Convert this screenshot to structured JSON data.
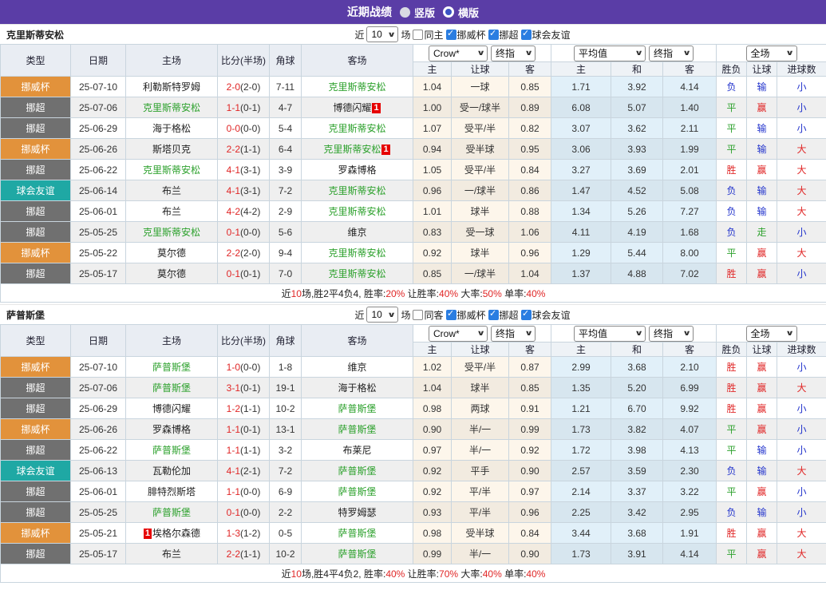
{
  "title_bar": {
    "title": "近期战绩",
    "radio_vertical": "竖版",
    "radio_horizontal": "横版"
  },
  "colors": {
    "header_purple": "#5a3da6",
    "league_cup_orange": "#e2923b",
    "league_top_gray": "#707070",
    "league_friendly_teal": "#1fa8a4",
    "win_red": "#e02626",
    "draw_green": "#2da12d",
    "lose_blue": "#2233cc",
    "highlight_team_green": "#2da12d"
  },
  "sections": [
    {
      "team": "克里斯蒂安松",
      "filter": {
        "near": "近",
        "count": "10",
        "unit": "场",
        "same": "同主",
        "cups": [
          "挪威杯",
          "挪超",
          "球会友谊"
        ]
      },
      "table": {
        "selects": {
          "book": "Crow*",
          "final1": "终指",
          "avg": "平均值",
          "final2": "终指",
          "scope": "全场"
        },
        "headers": {
          "type": "类型",
          "date": "日期",
          "home": "主场",
          "score": "比分(半场)",
          "corner": "角球",
          "away": "客场"
        },
        "sub": [
          "主",
          "让球",
          "客",
          "主",
          "和",
          "客",
          "胜负",
          "让球",
          "进球数"
        ]
      },
      "rows": [
        {
          "league": "挪威杯",
          "date": "25-07-10",
          "home": {
            "name": "利勒斯特罗姆"
          },
          "ft": "2-0",
          "ht": "(2-0)",
          "corner": "7-11",
          "away": {
            "name": "克里斯蒂安松",
            "hl": true
          },
          "crown": [
            "1.04",
            "一球",
            "0.85"
          ],
          "avg": [
            "1.71",
            "3.92",
            "4.14"
          ],
          "res": [
            "负",
            "输",
            "小"
          ]
        },
        {
          "league": "挪超",
          "date": "25-07-06",
          "home": {
            "name": "克里斯蒂安松",
            "hl": true
          },
          "ft": "1-1",
          "ht": "(0-1)",
          "corner": "4-7",
          "away": {
            "name": "博德闪耀",
            "card": "1",
            "card_pos": "suffix"
          },
          "crown": [
            "1.00",
            "受一/球半",
            "0.89"
          ],
          "avg": [
            "6.08",
            "5.07",
            "1.40"
          ],
          "res": [
            "平",
            "赢",
            "小"
          ]
        },
        {
          "league": "挪超",
          "date": "25-06-29",
          "home": {
            "name": "海于格松"
          },
          "ft": "0-0",
          "ht": "(0-0)",
          "corner": "5-4",
          "away": {
            "name": "克里斯蒂安松",
            "hl": true
          },
          "crown": [
            "1.07",
            "受平/半",
            "0.82"
          ],
          "avg": [
            "3.07",
            "3.62",
            "2.11"
          ],
          "res": [
            "平",
            "输",
            "小"
          ]
        },
        {
          "league": "挪威杯",
          "date": "25-06-26",
          "home": {
            "name": "斯塔贝克"
          },
          "ft": "2-2",
          "ht": "(1-1)",
          "corner": "6-4",
          "away": {
            "name": "克里斯蒂安松",
            "hl": true,
            "card": "1",
            "card_pos": "suffix"
          },
          "crown": [
            "0.94",
            "受半球",
            "0.95"
          ],
          "avg": [
            "3.06",
            "3.93",
            "1.99"
          ],
          "res": [
            "平",
            "输",
            "大"
          ]
        },
        {
          "league": "挪超",
          "date": "25-06-22",
          "home": {
            "name": "克里斯蒂安松",
            "hl": true
          },
          "ft": "4-1",
          "ht": "(3-1)",
          "corner": "3-9",
          "away": {
            "name": "罗森博格"
          },
          "crown": [
            "1.05",
            "受平/半",
            "0.84"
          ],
          "avg": [
            "3.27",
            "3.69",
            "2.01"
          ],
          "res": [
            "胜",
            "赢",
            "大"
          ]
        },
        {
          "league": "球会友谊",
          "date": "25-06-14",
          "home": {
            "name": "布兰"
          },
          "ft": "4-1",
          "ht": "(3-1)",
          "corner": "7-2",
          "away": {
            "name": "克里斯蒂安松",
            "hl": true
          },
          "crown": [
            "0.96",
            "一/球半",
            "0.86"
          ],
          "avg": [
            "1.47",
            "4.52",
            "5.08"
          ],
          "res": [
            "负",
            "输",
            "大"
          ]
        },
        {
          "league": "挪超",
          "date": "25-06-01",
          "home": {
            "name": "布兰"
          },
          "ft": "4-2",
          "ht": "(4-2)",
          "corner": "2-9",
          "away": {
            "name": "克里斯蒂安松",
            "hl": true
          },
          "crown": [
            "1.01",
            "球半",
            "0.88"
          ],
          "avg": [
            "1.34",
            "5.26",
            "7.27"
          ],
          "res": [
            "负",
            "输",
            "大"
          ]
        },
        {
          "league": "挪超",
          "date": "25-05-25",
          "home": {
            "name": "克里斯蒂安松",
            "hl": true
          },
          "ft": "0-1",
          "ht": "(0-0)",
          "corner": "5-6",
          "away": {
            "name": "维京"
          },
          "crown": [
            "0.83",
            "受一球",
            "1.06"
          ],
          "avg": [
            "4.11",
            "4.19",
            "1.68"
          ],
          "res": [
            "负",
            "走",
            "小"
          ]
        },
        {
          "league": "挪威杯",
          "date": "25-05-22",
          "home": {
            "name": "莫尔德"
          },
          "ft": "2-2",
          "ht": "(2-0)",
          "corner": "9-4",
          "away": {
            "name": "克里斯蒂安松",
            "hl": true
          },
          "crown": [
            "0.92",
            "球半",
            "0.96"
          ],
          "avg": [
            "1.29",
            "5.44",
            "8.00"
          ],
          "res": [
            "平",
            "赢",
            "大"
          ]
        },
        {
          "league": "挪超",
          "date": "25-05-17",
          "home": {
            "name": "莫尔德"
          },
          "ft": "0-1",
          "ht": "(0-1)",
          "corner": "7-0",
          "away": {
            "name": "克里斯蒂安松",
            "hl": true
          },
          "crown": [
            "0.85",
            "一/球半",
            "1.04"
          ],
          "avg": [
            "1.37",
            "4.88",
            "7.02"
          ],
          "res": [
            "胜",
            "赢",
            "小"
          ]
        }
      ],
      "summary": [
        {
          "t": "近"
        },
        {
          "t": "10",
          "red": true
        },
        {
          "t": "场,胜2平4负4, 胜率:"
        },
        {
          "t": "20%",
          "red": true
        },
        {
          "t": " 让胜率:"
        },
        {
          "t": "40%",
          "red": true
        },
        {
          "t": " 大率:"
        },
        {
          "t": "50%",
          "red": true
        },
        {
          "t": " 单率:"
        },
        {
          "t": "40%",
          "red": true
        }
      ]
    },
    {
      "team": "萨普斯堡",
      "filter": {
        "near": "近",
        "count": "10",
        "unit": "场",
        "same": "同客",
        "cups": [
          "挪威杯",
          "挪超",
          "球会友谊"
        ]
      },
      "table": {
        "selects": {
          "book": "Crow*",
          "final1": "终指",
          "avg": "平均值",
          "final2": "终指",
          "scope": "全场"
        },
        "headers": {
          "type": "类型",
          "date": "日期",
          "home": "主场",
          "score": "比分(半场)",
          "corner": "角球",
          "away": "客场"
        },
        "sub": [
          "主",
          "让球",
          "客",
          "主",
          "和",
          "客",
          "胜负",
          "让球",
          "进球数"
        ]
      },
      "rows": [
        {
          "league": "挪威杯",
          "date": "25-07-10",
          "home": {
            "name": "萨普斯堡",
            "hl": true
          },
          "ft": "1-0",
          "ht": "(0-0)",
          "corner": "1-8",
          "away": {
            "name": "维京"
          },
          "crown": [
            "1.02",
            "受平/半",
            "0.87"
          ],
          "avg": [
            "2.99",
            "3.68",
            "2.10"
          ],
          "res": [
            "胜",
            "赢",
            "小"
          ]
        },
        {
          "league": "挪超",
          "date": "25-07-06",
          "home": {
            "name": "萨普斯堡",
            "hl": true
          },
          "ft": "3-1",
          "ht": "(0-1)",
          "corner": "19-1",
          "away": {
            "name": "海于格松"
          },
          "crown": [
            "1.04",
            "球半",
            "0.85"
          ],
          "avg": [
            "1.35",
            "5.20",
            "6.99"
          ],
          "res": [
            "胜",
            "赢",
            "大"
          ]
        },
        {
          "league": "挪超",
          "date": "25-06-29",
          "home": {
            "name": "博德闪耀"
          },
          "ft": "1-2",
          "ht": "(1-1)",
          "corner": "10-2",
          "away": {
            "name": "萨普斯堡",
            "hl": true
          },
          "crown": [
            "0.98",
            "两球",
            "0.91"
          ],
          "avg": [
            "1.21",
            "6.70",
            "9.92"
          ],
          "res": [
            "胜",
            "赢",
            "小"
          ]
        },
        {
          "league": "挪威杯",
          "date": "25-06-26",
          "home": {
            "name": "罗森博格"
          },
          "ft": "1-1",
          "ht": "(0-1)",
          "corner": "13-1",
          "away": {
            "name": "萨普斯堡",
            "hl": true
          },
          "crown": [
            "0.90",
            "半/一",
            "0.99"
          ],
          "avg": [
            "1.73",
            "3.82",
            "4.07"
          ],
          "res": [
            "平",
            "赢",
            "小"
          ]
        },
        {
          "league": "挪超",
          "date": "25-06-22",
          "home": {
            "name": "萨普斯堡",
            "hl": true
          },
          "ft": "1-1",
          "ht": "(1-1)",
          "corner": "3-2",
          "away": {
            "name": "布莱尼"
          },
          "crown": [
            "0.97",
            "半/一",
            "0.92"
          ],
          "avg": [
            "1.72",
            "3.98",
            "4.13"
          ],
          "res": [
            "平",
            "输",
            "小"
          ]
        },
        {
          "league": "球会友谊",
          "date": "25-06-13",
          "home": {
            "name": "瓦勒伦加"
          },
          "ft": "4-1",
          "ht": "(2-1)",
          "corner": "7-2",
          "away": {
            "name": "萨普斯堡",
            "hl": true
          },
          "crown": [
            "0.92",
            "平手",
            "0.90"
          ],
          "avg": [
            "2.57",
            "3.59",
            "2.30"
          ],
          "res": [
            "负",
            "输",
            "大"
          ]
        },
        {
          "league": "挪超",
          "date": "25-06-01",
          "home": {
            "name": "腓特烈斯塔"
          },
          "ft": "1-1",
          "ht": "(0-0)",
          "corner": "6-9",
          "away": {
            "name": "萨普斯堡",
            "hl": true
          },
          "crown": [
            "0.92",
            "平/半",
            "0.97"
          ],
          "avg": [
            "2.14",
            "3.37",
            "3.22"
          ],
          "res": [
            "平",
            "赢",
            "小"
          ]
        },
        {
          "league": "挪超",
          "date": "25-05-25",
          "home": {
            "name": "萨普斯堡",
            "hl": true
          },
          "ft": "0-1",
          "ht": "(0-0)",
          "corner": "2-2",
          "away": {
            "name": "特罗姆瑟"
          },
          "crown": [
            "0.93",
            "平/半",
            "0.96"
          ],
          "avg": [
            "2.25",
            "3.42",
            "2.95"
          ],
          "res": [
            "负",
            "输",
            "小"
          ]
        },
        {
          "league": "挪威杯",
          "date": "25-05-21",
          "home": {
            "name": "埃格尔森德",
            "card": "1",
            "card_pos": "prefix"
          },
          "ft": "1-3",
          "ht": "(1-2)",
          "corner": "0-5",
          "away": {
            "name": "萨普斯堡",
            "hl": true
          },
          "crown": [
            "0.98",
            "受半球",
            "0.84"
          ],
          "avg": [
            "3.44",
            "3.68",
            "1.91"
          ],
          "res": [
            "胜",
            "赢",
            "大"
          ]
        },
        {
          "league": "挪超",
          "date": "25-05-17",
          "home": {
            "name": "布兰"
          },
          "ft": "2-2",
          "ht": "(1-1)",
          "corner": "10-2",
          "away": {
            "name": "萨普斯堡",
            "hl": true
          },
          "crown": [
            "0.99",
            "半/一",
            "0.90"
          ],
          "avg": [
            "1.73",
            "3.91",
            "4.14"
          ],
          "res": [
            "平",
            "赢",
            "大"
          ]
        }
      ],
      "summary": [
        {
          "t": "近"
        },
        {
          "t": "10",
          "red": true
        },
        {
          "t": "场,胜4平4负2, 胜率:"
        },
        {
          "t": "40%",
          "red": true
        },
        {
          "t": " 让胜率:"
        },
        {
          "t": "70%",
          "red": true
        },
        {
          "t": " 大率:"
        },
        {
          "t": "40%",
          "red": true
        },
        {
          "t": " 单率:"
        },
        {
          "t": "40%",
          "red": true
        }
      ]
    }
  ]
}
